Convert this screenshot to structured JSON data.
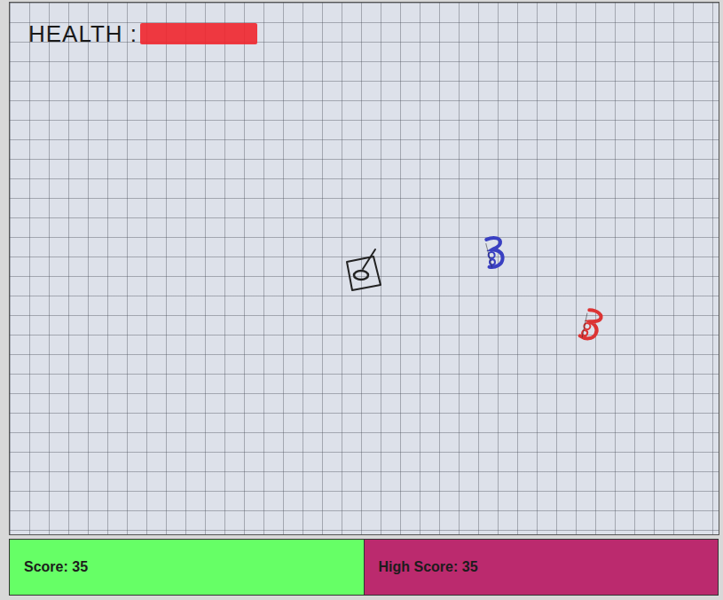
{
  "hud": {
    "health": {
      "label": "HEALTH :",
      "level": 1
    }
  },
  "enemies": [
    {
      "color": "#3a40c2"
    },
    {
      "color": "#dc3434"
    }
  ],
  "scoreboard": [
    {
      "label": "Score: 35",
      "color": "#66ff66"
    },
    {
      "label": "High Score: 35",
      "color": "#bb2a6e"
    }
  ]
}
